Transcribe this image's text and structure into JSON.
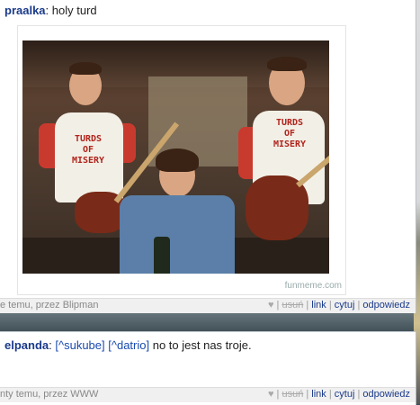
{
  "post1": {
    "username": "praalka",
    "separator": ":",
    "message": "holy turd",
    "image": {
      "watermark": "funmeme.com",
      "shirt_text": "TURDS\nOF\nMISERY"
    },
    "meta": "e temu, przez Blipman",
    "actions": {
      "heart": "♥",
      "delete": "usuń",
      "link": "link",
      "quote": "cytuj",
      "reply": "odpowiedz"
    }
  },
  "post2": {
    "username": "elpanda",
    "separator": ":",
    "mention1": "[^sukube]",
    "mention2": "[^datrio]",
    "message": "no to jest nas troje.",
    "meta": "nty temu, przez WWW",
    "actions": {
      "heart": "♥",
      "delete": "usuń",
      "link": "link",
      "quote": "cytuj",
      "reply": "odpowiedz"
    }
  }
}
